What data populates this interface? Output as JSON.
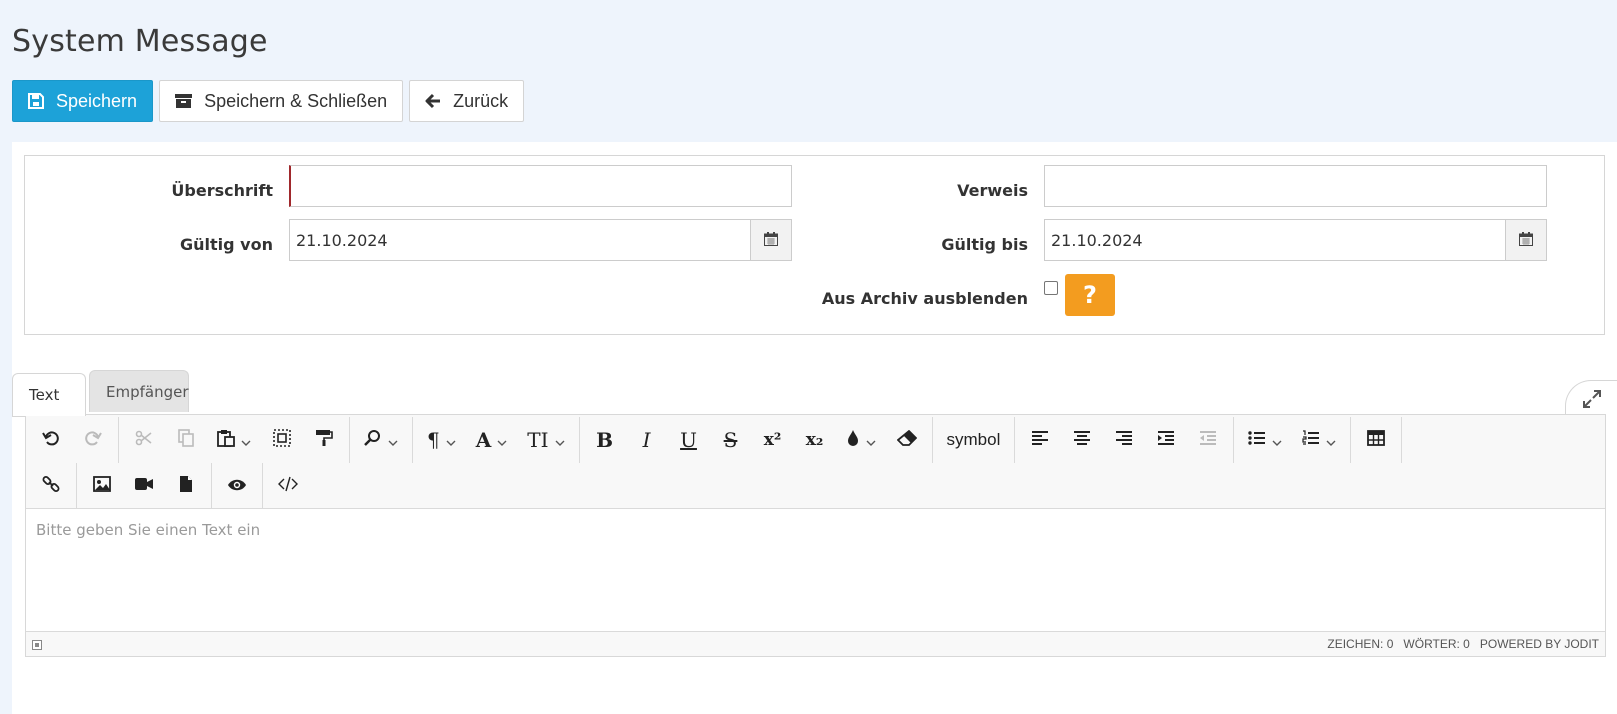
{
  "page": {
    "title": "System Message"
  },
  "toolbar": {
    "save_label": "Speichern",
    "save_close_label": "Speichern & Schließen",
    "back_label": "Zurück"
  },
  "form": {
    "headline": {
      "label": "Überschrift",
      "value": ""
    },
    "reference": {
      "label": "Verweis",
      "value": ""
    },
    "valid_from": {
      "label": "Gültig von",
      "value": "21.10.2024"
    },
    "valid_until": {
      "label": "Gültig bis",
      "value": "21.10.2024"
    },
    "hide_archive": {
      "label": "Aus Archiv ausblenden",
      "checked": false,
      "help_label": "?"
    }
  },
  "tabs": [
    {
      "label": "Text",
      "active": true
    },
    {
      "label": "Empfänger",
      "active": false
    }
  ],
  "editor": {
    "symbol_label": "symbol",
    "placeholder": "Bitte geben Sie einen Text ein",
    "status": {
      "chars": "ZEICHEN: 0",
      "words": "WÖRTER: 0",
      "powered": "POWERED BY JODIT"
    },
    "format_glyphs": {
      "bold": "B",
      "italic": "I",
      "underline": "U",
      "strikethrough": "S",
      "superscript": "x²",
      "subscript": "x₂",
      "paragraph": "¶",
      "font": "A",
      "font_size": "TI"
    }
  },
  "colors": {
    "primary": "#1da2d8",
    "help": "#f39c1f",
    "required": "#a0282c",
    "page_bg": "#eef4fc"
  }
}
